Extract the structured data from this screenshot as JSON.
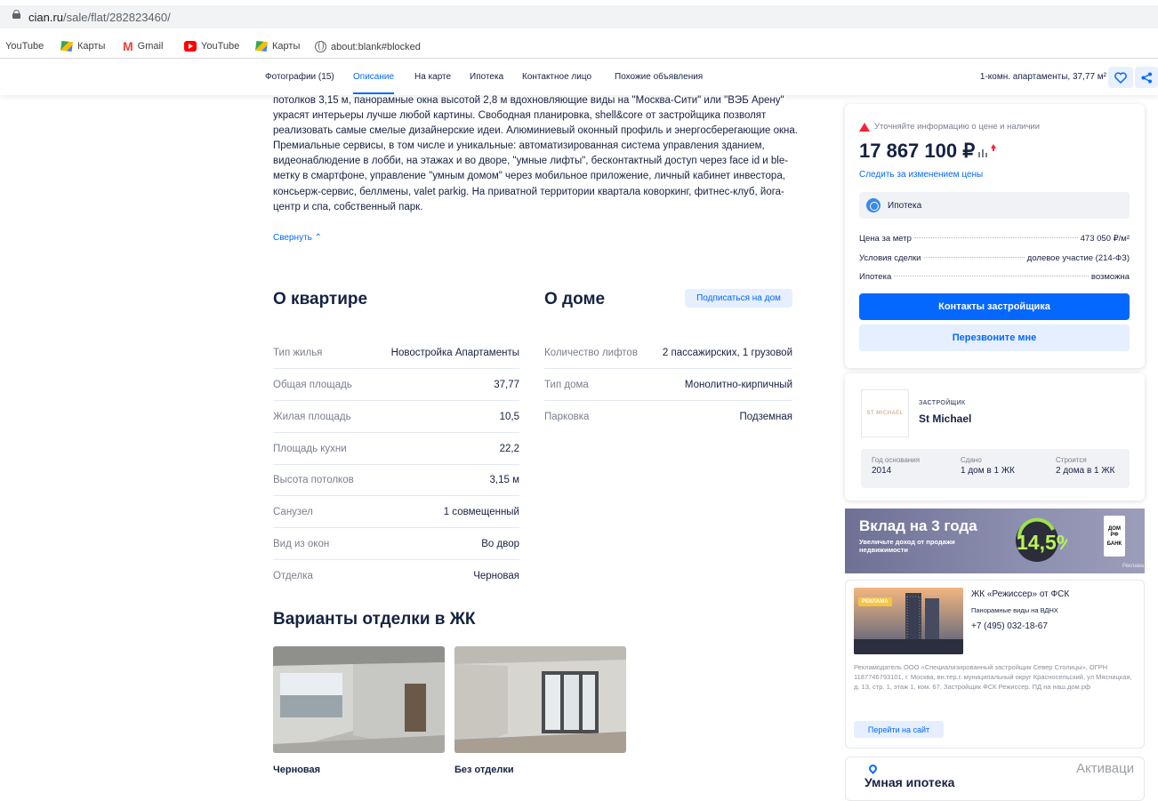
{
  "browser": {
    "url_host": "cian.ru",
    "url_path": "/sale/flat/282823460/",
    "bookmarks": [
      {
        "label": "YouTube",
        "icon": "none"
      },
      {
        "label": "Карты",
        "icon": "maps-icon"
      },
      {
        "label": "Gmail",
        "icon": "gmail-icon"
      },
      {
        "label": "YouTube",
        "icon": "youtube-icon"
      },
      {
        "label": "Карты",
        "icon": "maps-icon"
      },
      {
        "label": "about:blank#blocked",
        "icon": "globe-icon"
      }
    ]
  },
  "nav": {
    "tabs": [
      "Фотографии (15)",
      "Описание",
      "На карте",
      "Ипотека",
      "Контактное лицо",
      "Похожие объявления"
    ],
    "active_tab": "Описание",
    "summary": "1-комн. апартаменты, 37,77 м²",
    "heart_icon": "heart-icon",
    "share_icon": "share-icon"
  },
  "description": {
    "text": "потолков 3,15 м, панорамные окна высотой 2,8 м  вдохновляющие виды на \"Москва-Сити\" или \"ВЭБ Арену\" украсят интерьеры лучше любой картины. Свободная планировка, shell&core от застройщика позволят реализовать самые смелые дизайнерские идеи. Алюминиевый оконный профиль и энергосберегающие окна. Премиальные сервисы, в том числе и уникальные: автоматизированная система управления зданием, видеонаблюдение в лобби, на этажах и во дворе, \"умные лифты\", бесконтактный доступ через face id и ble-метку в смартфоне, управление \"умным домом\" через мобильное приложение, личный кабинет инвестора, консьерж-сервис, беллмены, valet parkig. На приватной территории квартала коворкинг, фитнес-клуб, йога-центр и спа, собственный парк.",
    "collapse_label": "Свернуть"
  },
  "apartment": {
    "title": "О квартире",
    "specs": [
      {
        "key": "Тип жилья",
        "value": "Новостройка Апартаменты"
      },
      {
        "key": "Общая площадь",
        "value": "37,77"
      },
      {
        "key": "Жилая площадь",
        "value": "10,5"
      },
      {
        "key": "Площадь кухни",
        "value": "22,2"
      },
      {
        "key": "Высота потолков",
        "value": "3,15 м"
      },
      {
        "key": "Санузел",
        "value": "1 совмещенный"
      },
      {
        "key": "Вид из окон",
        "value": "Во двор"
      },
      {
        "key": "Отделка",
        "value": "Черновая"
      }
    ]
  },
  "house": {
    "title": "О доме",
    "subscribe_label": "Подписаться на дом",
    "specs": [
      {
        "key": "Количество лифтов",
        "value": "2 пассажирских, 1 грузовой"
      },
      {
        "key": "Тип дома",
        "value": "Монолитно-кирпичный"
      },
      {
        "key": "Парковка",
        "value": "Подземная"
      }
    ]
  },
  "finishing": {
    "title": "Варианты отделки в ЖК",
    "options": [
      {
        "label": "Черновая"
      },
      {
        "label": "Без отделки"
      }
    ]
  },
  "price_card": {
    "warning": "Уточняйте информацию о цене и наличии",
    "price": "17 867 100 ₽",
    "follow_link": "Следить за изменением цены",
    "mortgage": "Ипотека",
    "rows": [
      {
        "key": "Цена за метр",
        "value": "473 050 ₽/м²"
      },
      {
        "key": "Условия сделки",
        "value": "долевое участие (214-ФЗ)"
      },
      {
        "key": "Ипотека",
        "value": "возможна"
      }
    ],
    "contacts_button": "Контакты застройщика",
    "callback_button": "Перезвоните мне"
  },
  "developer": {
    "logo_text": "ST MICHAEL",
    "kicker": "ЗАСТРОЙЩИК",
    "name": "St Michael",
    "stats": [
      {
        "label": "Год основания",
        "value": "2014"
      },
      {
        "label": "Сдано",
        "value": "1 дом в 1 ЖК"
      },
      {
        "label": "Строится",
        "value": "2 дома в 1 ЖК"
      }
    ]
  },
  "banner": {
    "title": "Вклад на 3 года",
    "subtitle": "Увеличьте доход от продажи недвижимости",
    "badge": "14,5%",
    "bank_mark": "ДОМ РФ",
    "bank_word": "БАНК",
    "ad_label": "Реклама"
  },
  "ad": {
    "tag": "РЕКЛАМА",
    "title": "ЖК «Режиссер» от ФСК",
    "subtitle": "Панорамные виды на ВДНХ",
    "phone": "+7 (495) 032-18-67",
    "legal": "Рекламодатель ООО «Специализированный застройщик Север Столицы», ОГРН 1187746793101, г. Москва, вн.тер.г. муниципальный округ Красносельский, ул Мясницкая, д. 13, стр. 1, этаж 1, ком. 67. Застройщик ФСК Режиссер. ПД на наш.дом.рф",
    "button": "Перейти на сайт"
  },
  "mortgage_teaser": {
    "title": "Умная ипотека"
  },
  "os_watermark": "Активаци"
}
